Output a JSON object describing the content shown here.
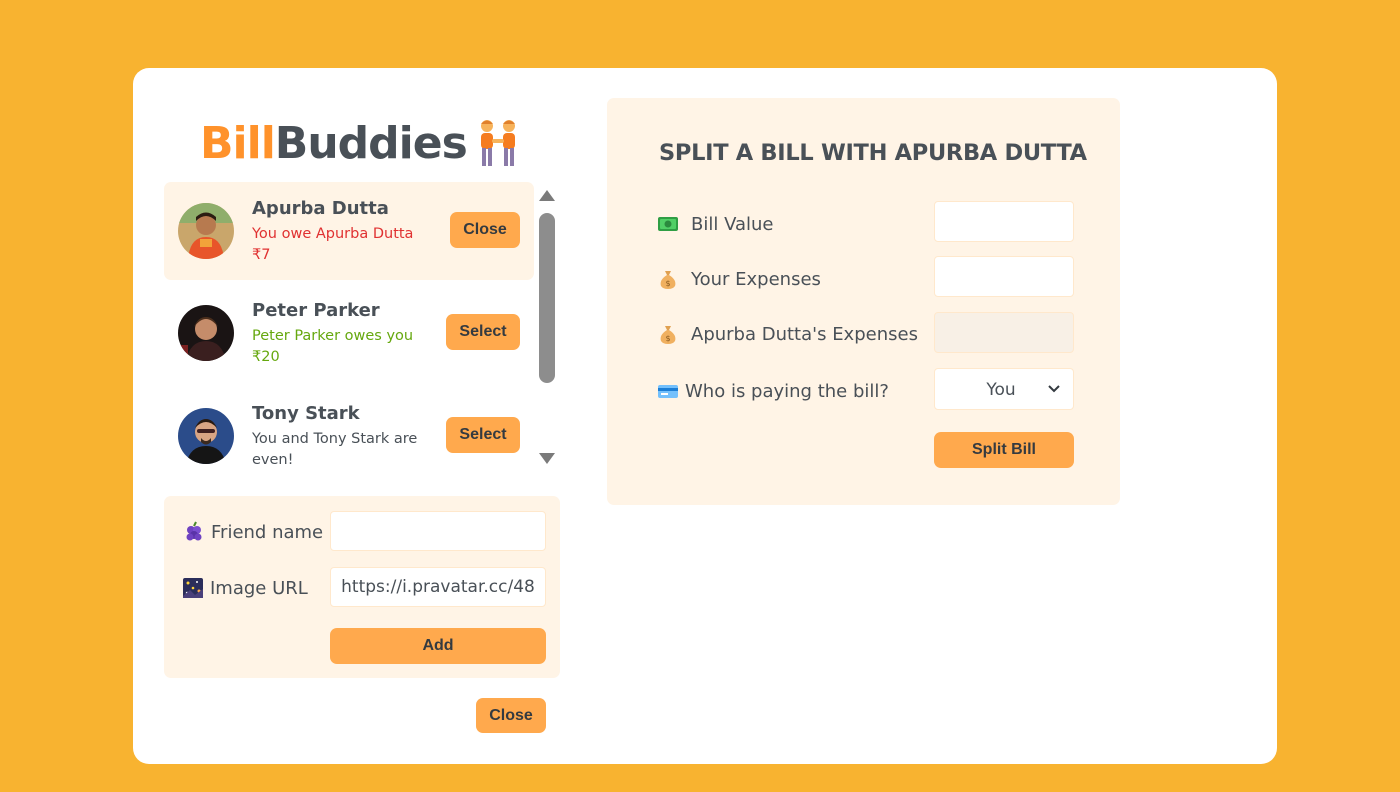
{
  "app": {
    "logo_part1": "Bill",
    "logo_part2": "Buddies",
    "brand_color": "#ff922b",
    "background_color": "#f8b330"
  },
  "friends": [
    {
      "name": "Apurba Dutta",
      "status_line1": "You owe Apurba Dutta",
      "status_line2": "₹7",
      "status_type": "owe",
      "button": "Close",
      "selected": true
    },
    {
      "name": "Peter Parker",
      "status_line1": "Peter Parker owes you",
      "status_line2": "₹20",
      "status_type": "owed",
      "button": "Select",
      "selected": false
    },
    {
      "name": "Tony Stark",
      "status_line1": "You and Tony Stark are",
      "status_line2": "even!",
      "status_type": "even",
      "button": "Select",
      "selected": false
    }
  ],
  "add_friend": {
    "name_icon": "grapes-icon",
    "name_label": "Friend name",
    "name_value": "",
    "image_icon": "picture-icon",
    "image_label": "Image URL",
    "image_value": "https://i.pravatar.cc/48",
    "add_button": "Add"
  },
  "close_form_button": "Close",
  "split": {
    "title": "Split a bill with Apurba Dutta",
    "bill_icon": "money-icon",
    "bill_label": "Bill Value",
    "bill_value": "",
    "your_icon": "moneybag-icon",
    "your_label": "Your Expenses",
    "your_value": "",
    "friend_icon": "moneybag-icon",
    "friend_label": "Apurba Dutta's Expenses",
    "friend_value": "",
    "payer_icon": "credit-card-icon",
    "payer_label": "Who is paying the bill?",
    "payer_value": "You",
    "split_button": "Split Bill"
  }
}
